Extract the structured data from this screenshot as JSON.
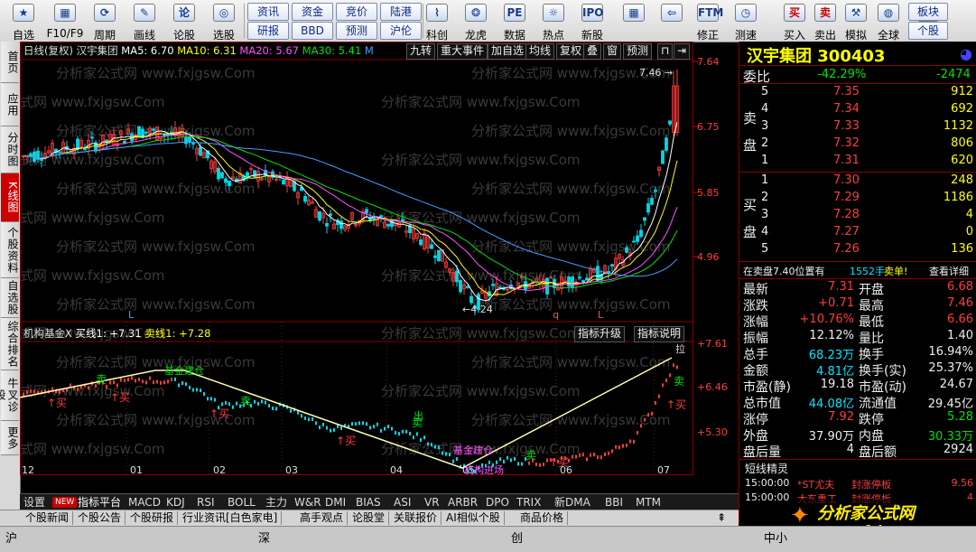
{
  "toolbar": {
    "buttons": [
      {
        "label": "自选",
        "icon": "★"
      },
      {
        "label": "F10/F9",
        "icon": "▦"
      },
      {
        "label": "周期",
        "icon": "⟳"
      },
      {
        "label": "画线",
        "icon": "✎"
      },
      {
        "label": "论股",
        "icon": "论"
      },
      {
        "label": "选股",
        "icon": "◎"
      }
    ],
    "grid_buttons": [
      [
        "资讯",
        "资金",
        "竞价",
        "陆港"
      ],
      [
        "研报",
        "BBD",
        "预测",
        "沪伦"
      ]
    ],
    "right_buttons": [
      {
        "label": "科创",
        "icon": "⌇"
      },
      {
        "label": "龙虎",
        "icon": "❂"
      },
      {
        "label": "数据",
        "icon": "PE"
      },
      {
        "label": "热点",
        "icon": "☼"
      },
      {
        "label": "新股",
        "icon": "IPO"
      },
      {
        "label": "",
        "icon": "▦"
      },
      {
        "label": "",
        "icon": "⇦"
      },
      {
        "label": "修正",
        "icon": "FTM"
      },
      {
        "label": "测速",
        "icon": "◷"
      },
      {
        "label": "买入",
        "icon": "买"
      },
      {
        "label": "卖出",
        "icon": "卖"
      },
      {
        "label": "模拟",
        "icon": "⚒"
      },
      {
        "label": "全球",
        "icon": "◍"
      },
      {
        "label": "个股",
        "icon": "?"
      }
    ],
    "board_buttons": [
      "板块",
      "个股"
    ]
  },
  "left_tabs": [
    "首页",
    "应用",
    "分时图",
    "K线图",
    "个股资料",
    "自选股",
    "综合排名",
    "牛叉诊股",
    "更多"
  ],
  "main_header": {
    "prefix": "日线(复权)",
    "stock": "汉宇集团",
    "ma5": "MA5: 6.70",
    "ma10": "MA10: 6.31",
    "ma20": "MA20: 5.67",
    "ma30": "MA30: 5.41",
    "m": "M",
    "buttons": [
      "九转",
      "重大事件",
      "加自选",
      "均线",
      "复权",
      "叠",
      "窗",
      "预测"
    ]
  },
  "main_axis": [
    "7.64",
    "6.75",
    "5.85",
    "4.96"
  ],
  "main_annotations": {
    "high": "7.46",
    "low": "4.24",
    "l1": "L",
    "l2": "L",
    "q": "q"
  },
  "sub_header": {
    "name": "机构基金X",
    "buy": "买线1: +7.31",
    "sell": "卖线1: +7.28",
    "buttons": [
      "指标升级",
      "指标说明"
    ]
  },
  "sub_axis": [
    "+7.61",
    "+6.46",
    "+5.30"
  ],
  "sub_labels": {
    "buy": "买",
    "sell": "卖",
    "base": "基金建仓",
    "inst": "机构进场",
    "exit": "出",
    "pull": "拉"
  },
  "months": [
    "12",
    "01",
    "02",
    "03",
    "04",
    "05",
    "06",
    "07"
  ],
  "watermark": "分析家公式网 www.fxjgsw.Com",
  "indicator_tabs": [
    "设置",
    "NEW",
    "指标平台",
    "MACD",
    "KDJ",
    "RSI",
    "BOLL",
    "主力",
    "W&R",
    "DMI",
    "BIAS",
    "ASI",
    "VR",
    "ARBR",
    "DPO",
    "TRIX",
    "新DMA",
    "BBI",
    "MTM"
  ],
  "info_tabs": [
    "个股新闻",
    "个股公告",
    "个股研报",
    "行业资讯[白色家电]",
    "高手观点",
    "论股堂",
    "关联报价",
    "AI相似个股",
    "商品价格"
  ],
  "status": {
    "sh": "沪",
    "sz": "深",
    "cy": "创",
    "zx": "中小"
  },
  "quote": {
    "title": "汉宇集团",
    "code": "300403",
    "weibi_label": "委比",
    "weibi": "-42.29%",
    "weicha": "-2474",
    "sell_label": "卖盘",
    "buy_label": "买盘",
    "asks": [
      [
        "5",
        "7.35",
        "912"
      ],
      [
        "4",
        "7.34",
        "692"
      ],
      [
        "3",
        "7.33",
        "1132"
      ],
      [
        "2",
        "7.32",
        "806"
      ],
      [
        "1",
        "7.31",
        "620"
      ]
    ],
    "bids": [
      [
        "1",
        "7.30",
        "248"
      ],
      [
        "2",
        "7.29",
        "1186"
      ],
      [
        "3",
        "7.28",
        "4"
      ],
      [
        "4",
        "7.27",
        "0"
      ],
      [
        "5",
        "7.26",
        "136"
      ]
    ],
    "order_note": "在卖盘7.40位置有",
    "order_qty": "1552手",
    "order_type": "卖单!",
    "order_link": "查看详细",
    "stats": [
      [
        "最新",
        "7.31",
        "开盘",
        "6.68"
      ],
      [
        "涨跌",
        "+0.71",
        "最高",
        "7.46"
      ],
      [
        "涨幅",
        "+10.76%",
        "最低",
        "6.66"
      ],
      [
        "振幅",
        "12.12%",
        "量比",
        "1.40"
      ],
      [
        "总手",
        "68.23万",
        "换手",
        "16.94%"
      ],
      [
        "金额",
        "4.81亿",
        "换手(实)",
        "25.37%"
      ],
      [
        "市盈(静)",
        "19.18",
        "市盈(动)",
        "24.67"
      ],
      [
        "总市值",
        "44.08亿",
        "流通值",
        "29.45亿"
      ],
      [
        "涨停",
        "7.92",
        "跌停",
        "5.28"
      ],
      [
        "外盘",
        "37.90万",
        "内盘",
        "30.33万"
      ],
      [
        "盘后量",
        "4",
        "盘后额",
        "2924"
      ]
    ],
    "news_title": "短线精灵",
    "news": [
      [
        "15:00:00",
        "*ST尤夫",
        "封涨停板",
        "9.56"
      ],
      [
        "15:00:00",
        "大东重工",
        "封涨停板",
        "4"
      ]
    ],
    "brand": "分析家公式网",
    "brand_url": "www.fxjgsw.com"
  },
  "colors": {
    "up": "#ff3c3c",
    "down": "#00d8e8",
    "ma5": "#ffffff",
    "ma10": "#ffff00",
    "ma20": "#ff50ff",
    "ma30": "#00e000",
    "ma60": "#40a0ff",
    "accent": "#c00000"
  }
}
